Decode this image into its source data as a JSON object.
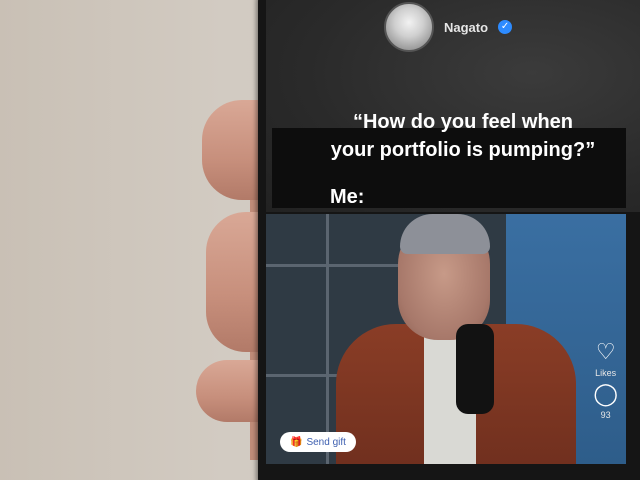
{
  "profile": {
    "username": "Nagato",
    "verified_icon": "verified-badge-icon"
  },
  "caption": {
    "line1": "“How do you feel when",
    "line2": "your portfolio is pumping?”",
    "reply": "Me:"
  },
  "sidebar": {
    "likes_label": "Likes",
    "comments_count": "93"
  },
  "send_gift": {
    "label": "Send gift",
    "icon": "gift-icon"
  },
  "colors": {
    "phone": "#151515",
    "caption_text": "#ffffff",
    "verified": "#2d8bff",
    "gift_text": "#3d5fb0",
    "jacket": "#8a3d26"
  }
}
